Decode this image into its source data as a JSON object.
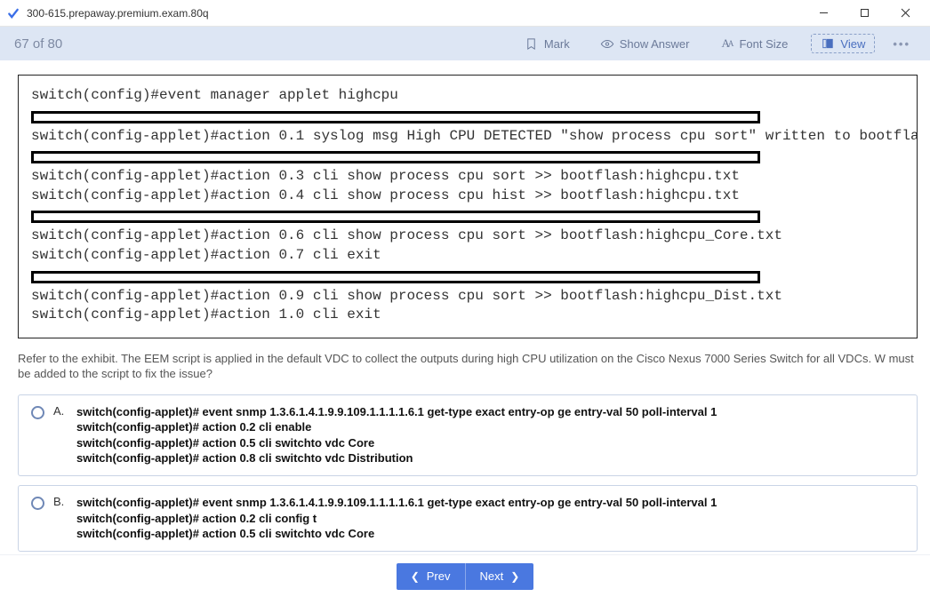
{
  "window": {
    "title": "300-615.prepaway.premium.exam.80q"
  },
  "toolbar": {
    "counter": "67 of 80",
    "mark_label": "Mark",
    "show_answer_label": "Show Answer",
    "font_size_label": "Font Size",
    "view_label": "View",
    "more_label": "•••"
  },
  "exhibit": {
    "l1": "switch(config)#event manager applet highcpu",
    "l2": "switch(config-applet)#action 0.1 syslog msg High CPU DETECTED \"show process cpu sort\" written to bootfla",
    "l3": "switch(config-applet)#action 0.3 cli show process cpu sort >> bootflash:highcpu.txt",
    "l4": "switch(config-applet)#action 0.4 cli show process cpu hist >> bootflash:highcpu.txt",
    "l5": "switch(config-applet)#action 0.6 cli show process cpu sort >> bootflash:highcpu_Core.txt",
    "l6": "switch(config-applet)#action 0.7 cli exit",
    "l7": "switch(config-applet)#action 0.9 cli show process cpu sort >> bootflash:highcpu_Dist.txt",
    "l8": "switch(config-applet)#action 1.0 cli exit"
  },
  "question": "Refer to the exhibit. The EEM script is applied in the default VDC to collect the outputs during high CPU utilization on the Cisco Nexus 7000 Series Switch for all VDCs. W must be added to the script to fix the issue?",
  "options": {
    "a_letter": "A.",
    "a_text": "switch(config-applet)# event snmp 1.3.6.1.4.1.9.9.109.1.1.1.1.6.1 get-type exact entry-op ge entry-val 50 poll-interval 1\nswitch(config-applet)# action 0.2 cli enable\nswitch(config-applet)# action 0.5 cli switchto vdc Core\nswitch(config-applet)# action 0.8 cli switchto vdc Distribution",
    "b_letter": "B.",
    "b_text": "switch(config-applet)# event snmp 1.3.6.1.4.1.9.9.109.1.1.1.1.6.1 get-type exact entry-op ge entry-val 50 poll-interval 1\nswitch(config-applet)# action 0.2 cli config t\nswitch(config-applet)# action 0.5 cli switchto vdc Core"
  },
  "nav": {
    "prev": "Prev",
    "next": "Next"
  }
}
